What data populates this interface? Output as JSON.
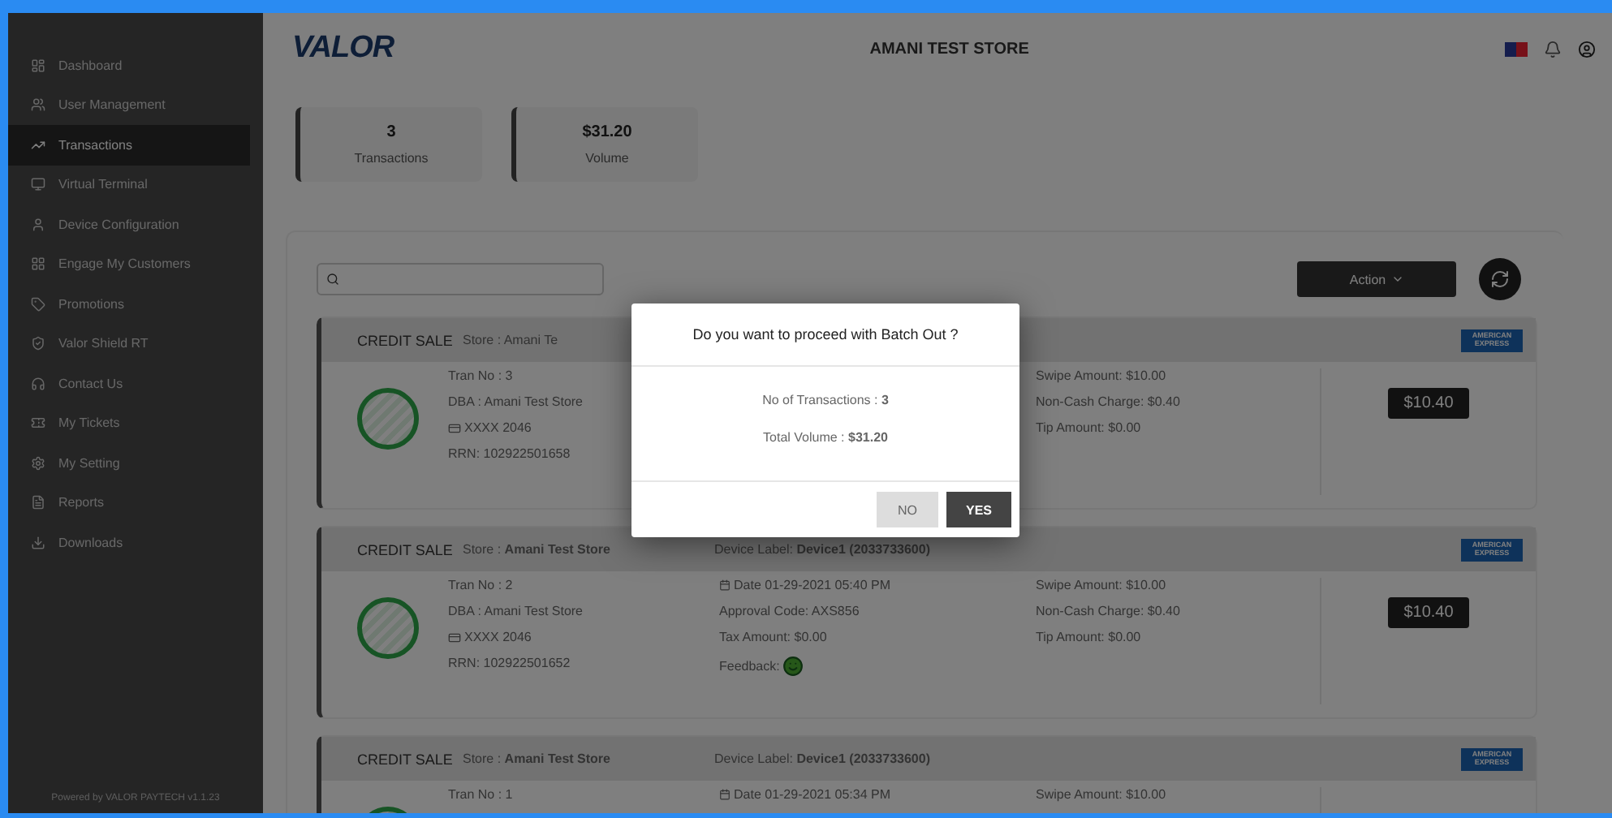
{
  "sidebar": {
    "items": [
      {
        "label": "Dashboard",
        "selected": false
      },
      {
        "label": "User Management",
        "selected": false
      },
      {
        "label": "Transactions",
        "selected": true
      },
      {
        "label": "Virtual Terminal",
        "selected": false
      },
      {
        "label": "Device Configuration",
        "selected": false
      },
      {
        "label": "Engage My Customers",
        "selected": false
      },
      {
        "label": "Promotions",
        "selected": false
      },
      {
        "label": "Valor Shield RT",
        "selected": false
      },
      {
        "label": "Contact Us",
        "selected": false
      },
      {
        "label": "My Tickets",
        "selected": false
      },
      {
        "label": "My Setting",
        "selected": false
      },
      {
        "label": "Reports",
        "selected": false
      },
      {
        "label": "Downloads",
        "selected": false
      }
    ],
    "footer": "Powered by VALOR PAYTECH v1.1.23"
  },
  "header": {
    "logo": "VALOR",
    "store": "AMANI TEST STORE"
  },
  "stats": [
    {
      "value": "3",
      "label": "Transactions"
    },
    {
      "value": "$31.20",
      "label": "Volume"
    }
  ],
  "action_button": {
    "label": "Action"
  },
  "transactions": [
    {
      "type": "CREDIT SALE",
      "store": "Store : Amani Te",
      "brand": "AMERICAN EXPRESS",
      "tran_no": "Tran No : 3",
      "dba": "DBA : Amani Test Store",
      "card": "XXXX 2046",
      "rrn": "RRN: 102922501658",
      "swipe": "Swipe Amount: $10.00",
      "non_cash": "Non-Cash Charge: $0.40",
      "tip": "Tip Amount: $0.00",
      "amount": "$10.40"
    },
    {
      "type": "CREDIT SALE",
      "store": "Store : **Amani Test Store**",
      "device": "Device Label: **Device1 (2033733600)**",
      "brand": "AMERICAN EXPRESS",
      "tran_no": "Tran No : 2",
      "dba": "DBA : Amani Test Store",
      "card": "XXXX 2046",
      "rrn": "RRN: 102922501652",
      "date": "Date 01-29-2021 05:40 PM",
      "approval": "Approval Code: AXS856",
      "tax": "Tax Amount: $0.00",
      "feedback": "Feedback:",
      "swipe": "Swipe Amount: $10.00",
      "non_cash": "Non-Cash Charge: $0.40",
      "tip": "Tip Amount: $0.00",
      "amount": "$10.40"
    },
    {
      "type": "CREDIT SALE",
      "store": "Store : **Amani Test Store**",
      "device": "Device Label: **Device1 (2033733600)**",
      "brand": "AMERICAN EXPRESS",
      "tran_no": "Tran No : 1",
      "date": "Date 01-29-2021 05:34 PM",
      "swipe": "Swipe Amount: $10.00"
    }
  ],
  "modal": {
    "title": "Do you want to proceed with Batch Out ?",
    "lines": [
      "No of Transactions : **3**",
      "Total Volume : **$31.20**"
    ],
    "buttons": [
      {
        "label": "NO",
        "kind": "secondary"
      },
      {
        "label": "YES",
        "kind": "primary"
      }
    ]
  }
}
